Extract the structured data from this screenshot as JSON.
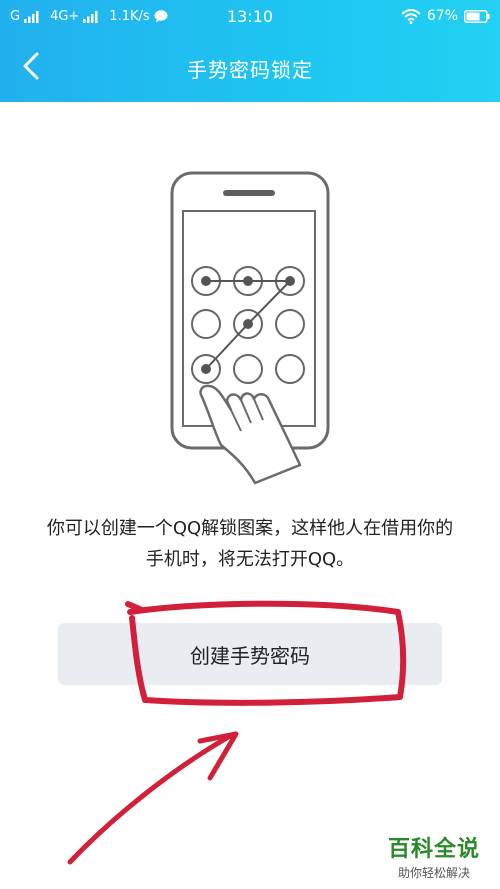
{
  "status_bar": {
    "carrier": "G",
    "network": "4G+",
    "speed": "1.1K/s",
    "time": "13:10",
    "battery": "67%",
    "icons": [
      "signal-icon",
      "chat-bubble-icon",
      "wifi-icon",
      "battery-icon"
    ]
  },
  "nav": {
    "title": "手势密码锁定",
    "back_icon": "chevron-left-icon"
  },
  "description": "你可以创建一个QQ解锁图案，这样他人在借用你的手机时，将无法打开QQ。",
  "create_button_label": "创建手势密码",
  "watermark": {
    "main": "百科全说",
    "sub": "助你轻松解决"
  },
  "colors": {
    "header_start": "#22b0ee",
    "header_end": "#23d0f3",
    "button_bg": "#e9ecf1",
    "annotation_red": "#d2203a",
    "watermark_green": "#2a8a2a"
  }
}
